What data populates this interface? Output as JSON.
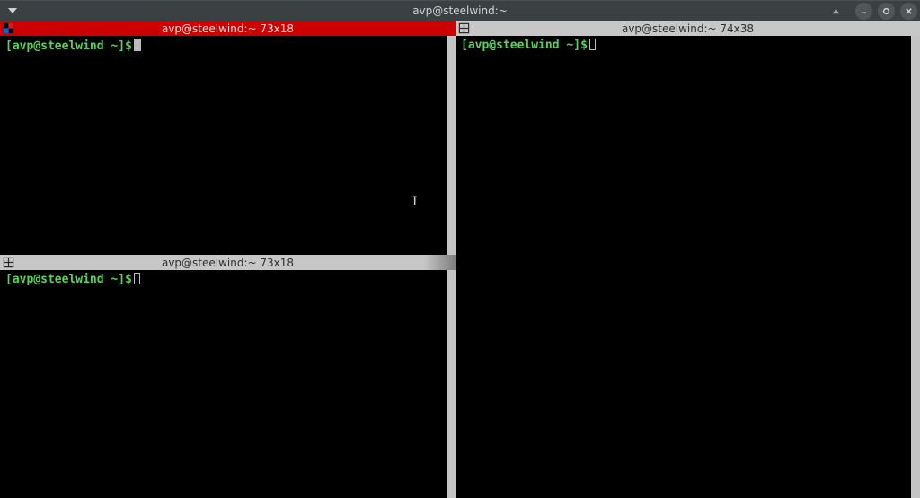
{
  "window": {
    "title": "avp@steelwind:~"
  },
  "panes": {
    "top_left": {
      "title": "avp@steelwind:~ 73x18",
      "active": true,
      "prompt": {
        "open": "[",
        "user_host": "avp@steelwind",
        "space1": " ",
        "path": "~",
        "close": "]",
        "symbol": "$"
      }
    },
    "bottom_left": {
      "title": "avp@steelwind:~ 73x18",
      "active": false,
      "prompt": {
        "open": "[",
        "user_host": "avp@steelwind",
        "space1": " ",
        "path": "~",
        "close": "]",
        "symbol": "$"
      }
    },
    "right": {
      "title": "avp@steelwind:~ 74x38",
      "active": false,
      "prompt": {
        "open": "[",
        "user_host": "avp@steelwind",
        "space1": " ",
        "path": "~",
        "close": "]",
        "symbol": "$"
      }
    }
  }
}
